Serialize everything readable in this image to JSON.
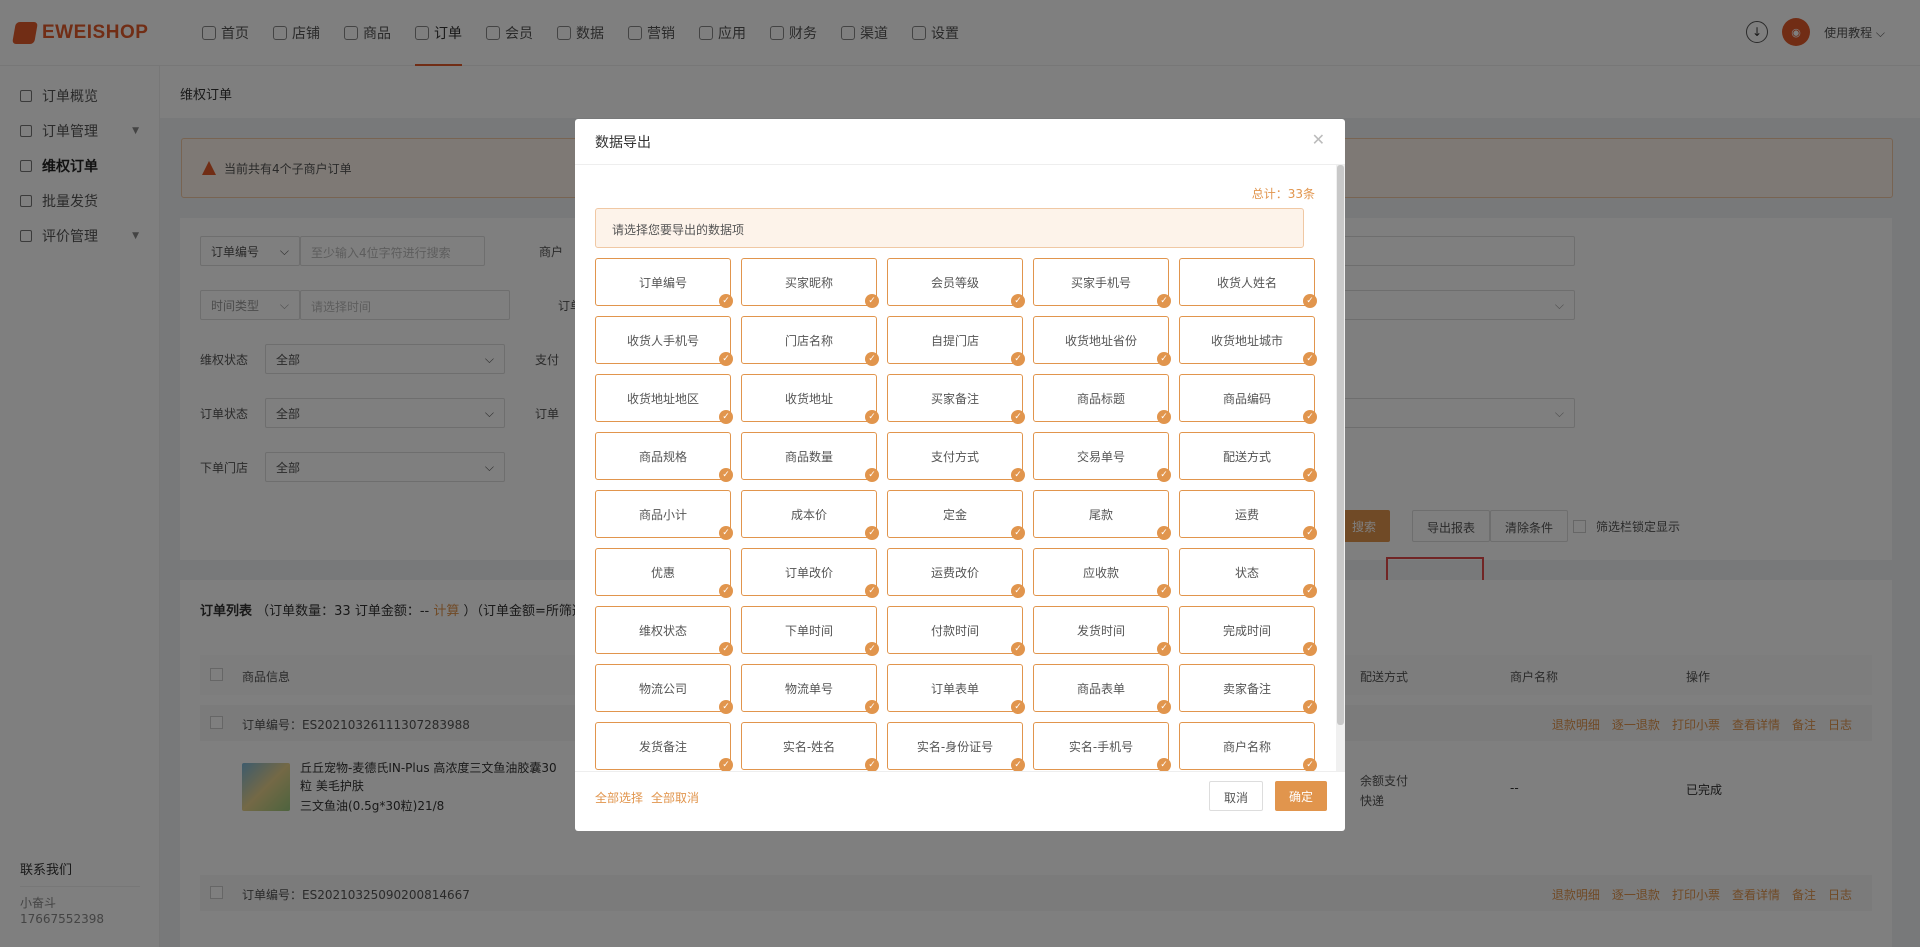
{
  "brand": {
    "name": "EWEISHOP"
  },
  "nav": [
    {
      "label": "首页",
      "icon": "home-icon"
    },
    {
      "label": "店铺",
      "icon": "store-icon"
    },
    {
      "label": "商品",
      "icon": "goods-icon"
    },
    {
      "label": "订单",
      "icon": "order-icon",
      "active": true
    },
    {
      "label": "会员",
      "icon": "member-icon"
    },
    {
      "label": "数据",
      "icon": "data-icon"
    },
    {
      "label": "营销",
      "icon": "marketing-icon"
    },
    {
      "label": "应用",
      "icon": "app-icon"
    },
    {
      "label": "财务",
      "icon": "finance-icon"
    },
    {
      "label": "渠道",
      "icon": "channel-icon"
    },
    {
      "label": "设置",
      "icon": "settings-icon"
    }
  ],
  "header": {
    "user_link": "使用教程 ⌵"
  },
  "sidebar": {
    "items": [
      {
        "label": "订单概览"
      },
      {
        "label": "订单管理",
        "arrow": true
      },
      {
        "label": "维权订单",
        "active": true
      },
      {
        "label": "批量发货"
      },
      {
        "label": "评价管理",
        "arrow": true
      }
    ],
    "contact_title": "联系我们",
    "contact_name": "小奋斗",
    "contact_phone": "17667552398"
  },
  "main": {
    "breadcrumb": "维权订单",
    "notice": "当前共有4个子商户订单",
    "filters": {
      "order_no_type": "订单编号",
      "order_no_placeholder": "至少输入4位字符进行搜索",
      "merchant_label": "商户",
      "time_type": "时间类型",
      "time_placeholder": "请选择时间",
      "order_label": "订单",
      "rights_status_label": "维权状态",
      "rights_status_value": "全部",
      "pay_label": "支付",
      "order_status_label": "订单状态",
      "order_status_value": "全部",
      "order_label2": "订单",
      "store_label": "下单门店",
      "store_value": "全部",
      "search_btn": "搜索",
      "export_btn": "导出报表",
      "clear_btn": "清除条件",
      "pin_label": "筛选栏锁定显示"
    },
    "list": {
      "title": "订单列表",
      "summary_prefix": "（订单数量：33 订单金额：-- ",
      "summary_calc": "计算",
      "summary_suffix": "）（订单金额=所筛选订",
      "col_product": "商品信息",
      "col_delivery": "配送方式",
      "col_merchant": "商户名称",
      "col_ops": "操作",
      "orders": [
        {
          "order_no": "订单编号：ES20210326111307283988",
          "product_title": "丘丘宠物-麦德氏IN-Plus 高浓度三文鱼油胶囊30粒 美毛护肤",
          "product_spec": "三文鱼油(0.5g*30粒)21/8",
          "pay": "余额支付",
          "delivery": "快递",
          "merchant": "--",
          "status": "已完成"
        },
        {
          "order_no": "订单编号：ES20210325090200814667"
        }
      ],
      "actions": [
        "退款明细",
        "逐一退款",
        "打印小票",
        "查看详情",
        "备注",
        "日志"
      ]
    }
  },
  "dialog": {
    "title": "数据导出",
    "total": "总计：33条",
    "tip": "请选择您要导出的数据项",
    "options": [
      "订单编号",
      "买家昵称",
      "会员等级",
      "买家手机号",
      "收货人姓名",
      "收货人手机号",
      "门店名称",
      "自提门店",
      "收货地址省份",
      "收货地址城市",
      "收货地址地区",
      "收货地址",
      "买家备注",
      "商品标题",
      "商品编码",
      "商品规格",
      "商品数量",
      "支付方式",
      "交易单号",
      "配送方式",
      "商品小计",
      "成本价",
      "定金",
      "尾款",
      "运费",
      "优惠",
      "订单改价",
      "运费改价",
      "应收款",
      "状态",
      "维权状态",
      "下单时间",
      "付款时间",
      "发货时间",
      "完成时间",
      "物流公司",
      "物流单号",
      "订单表单",
      "商品表单",
      "卖家备注",
      "发货备注",
      "实名-姓名",
      "实名-身份证号",
      "实名-手机号",
      "商户名称"
    ],
    "select_all": "全部选择",
    "cancel_all": "全部取消",
    "cancel_btn": "取消",
    "ok_btn": "确定"
  },
  "colors": {
    "accent": "#e1954d",
    "brand": "#e35a2a",
    "highlight": "#e24b4b"
  }
}
